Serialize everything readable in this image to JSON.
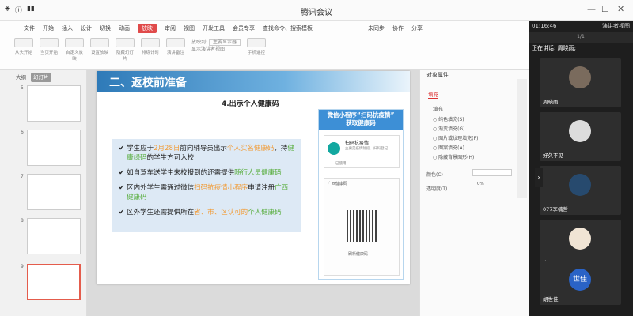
{
  "window": {
    "title": "腾讯会议",
    "time": "01:16:46",
    "view_mode": "演讲者视图"
  },
  "ribbon": {
    "tabs": [
      "开始",
      "插入",
      "设计",
      "切换",
      "动画",
      "放映",
      "审阅",
      "视图",
      "开发工具",
      "会员专享",
      "查找命令、搜索模板"
    ],
    "active_tab": "放映",
    "file_label": "文件",
    "share_labels": [
      "未同步",
      "协作",
      "分享"
    ],
    "tools": [
      "从头开始",
      "当页开始",
      "自定义放映",
      "设置放映",
      "隐藏幻灯片",
      "排练计时",
      "演讲备注"
    ],
    "monitor_label": "放映到:",
    "monitor_value": "主要显示器",
    "presenter_view_label": "显示演讲者视图",
    "phone_remote_label": "手机遥控"
  },
  "thumbnails": {
    "tabs": [
      "大纲",
      "幻灯片"
    ],
    "active_tab": "幻灯片",
    "numbers": [
      "5",
      "6",
      "7",
      "8",
      "9"
    ]
  },
  "slide": {
    "section_title": "二、返校前准备",
    "subtitle": "4.出示个人健康码",
    "bullets": [
      {
        "parts": [
          "学生应于",
          "2月28日",
          "前向辅导员出示",
          "个人实名健康码",
          "，持",
          "健康绿码",
          "的学生方可入校"
        ]
      },
      {
        "parts": [
          "如自驾车送学生来校报到的还需提供",
          "随行人员健康码"
        ]
      },
      {
        "parts": [
          "区内外学生需通过微信",
          "扫码抗疫情小程序",
          "申请注册",
          "广西健康码"
        ]
      },
      {
        "parts": [
          "区外学生还需提供所在",
          "省、市、区认可的",
          "个人健康码"
        ]
      }
    ],
    "phone_heading_1": "微信小程序“扫码抗疫情”",
    "phone_heading_2": "获取健康码",
    "mini_app_title": "扫码抗疫情",
    "mini_app_desc": "主要是疫情防控、扫码登记",
    "mini_app_count": "已使用",
    "qr_card_title": "广西健康码",
    "qr_footer": "刷新健康码"
  },
  "properties": {
    "title": "对象属性",
    "tab": "填充",
    "fill_header": "填充",
    "options": [
      "纯色填充(S)",
      "渐变填充(G)",
      "图片或纹理填充(P)",
      "图案填充(A)",
      "隐藏背景图形(H)"
    ],
    "color_label": "颜色(C)",
    "transparency_label": "透明度(T)",
    "transparency_value": "0%"
  },
  "participants": {
    "speaking_label": "正在讲话: 周晓雨;",
    "pager": "1/1",
    "tiles": [
      {
        "name": "周晓雨",
        "avatar_color": "#7a6b5d"
      },
      {
        "name": "好久不见",
        "avatar_color": "#dcdcdc"
      },
      {
        "name": "077李楠哲",
        "avatar_color": "#274a6e"
      },
      {
        "name": "卢明",
        "avatar_color": "#f0e4d4"
      },
      {
        "name": "胡世佳",
        "avatar_color": "#2a63c6",
        "initials": "世佳"
      }
    ]
  },
  "colors": {
    "accent": "#e04a4a",
    "slide_blue": "#2e7ab8",
    "orange": "#f19c38",
    "green": "#5aae40"
  }
}
